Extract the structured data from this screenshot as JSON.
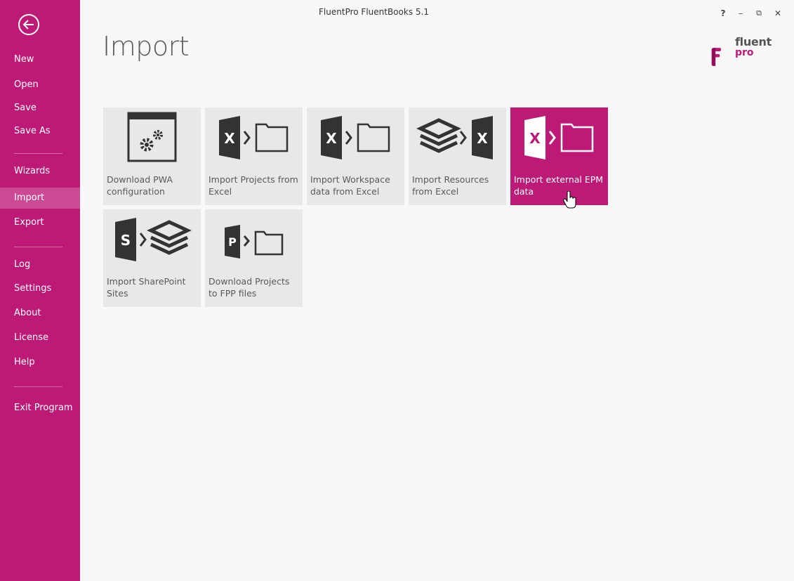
{
  "window": {
    "title": "FluentPro FluentBooks 5.1",
    "controls": {
      "help": "?",
      "minimize": "–",
      "restore": "⧉",
      "close": "✕"
    }
  },
  "page": {
    "title": "Import"
  },
  "logo": {
    "line1": "fluent",
    "line2": "pro"
  },
  "colors": {
    "accent": "#bc1a76",
    "active_nav": "#cc4a93",
    "tile_bg": "#e8e8e6"
  },
  "sidebar": {
    "back_icon": "arrow-left-circle-icon",
    "items": [
      {
        "label": "New"
      },
      {
        "label": "Open"
      },
      {
        "label": "Save"
      },
      {
        "label": "Save As"
      },
      {
        "label": "Wizards"
      },
      {
        "label": "Import",
        "active": true
      },
      {
        "label": "Export"
      },
      {
        "label": "Log"
      },
      {
        "label": "Settings"
      },
      {
        "label": "About"
      },
      {
        "label": "License"
      },
      {
        "label": "Help"
      },
      {
        "label": "Exit Program"
      }
    ]
  },
  "tiles": [
    {
      "label": "Download PWA configuration",
      "icon": "gears-window-icon"
    },
    {
      "label": "Import Projects from Excel",
      "icon": "excel-to-folder-icon"
    },
    {
      "label": "Import Workspace data from Excel",
      "icon": "excel-to-folder-icon"
    },
    {
      "label": "Import Resources from Excel",
      "icon": "layers-to-excel-icon"
    },
    {
      "label": "Import external EPM data",
      "icon": "excel-to-folder-icon",
      "highlighted": true
    },
    {
      "label": "Import SharePoint Sites",
      "icon": "sharepoint-to-layers-icon"
    },
    {
      "label": "Download Projects to FPP files",
      "icon": "project-to-folder-icon"
    }
  ]
}
